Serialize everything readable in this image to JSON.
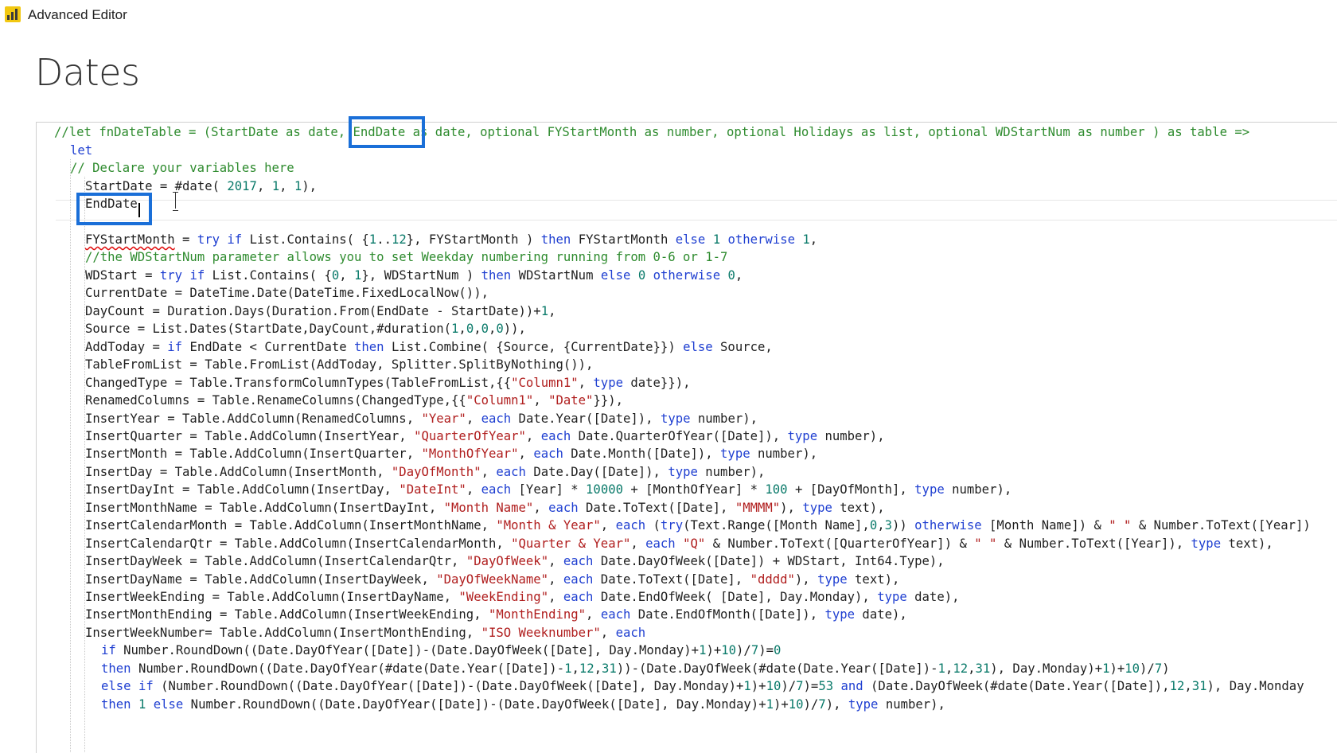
{
  "window": {
    "title": "Advanced Editor",
    "icon": "power-bi-icon"
  },
  "page": {
    "title": "Dates"
  },
  "editor": {
    "lines": [
      "//let fnDateTable = (StartDate as date, EndDate as date, optional FYStartMonth as number, optional Holidays as list, optional WDStartNum as number ) as table =>",
      "let",
      "// Declare your variables here",
      "StartDate = #date( 2017, 1, 1),",
      "EndDate",
      "FYStartMonth = try if List.Contains( {1..12}, FYStartMonth ) then FYStartMonth else 1 otherwise 1,",
      "//the WDStartNum parameter allows you to set Weekday numbering running from 0-6 or 1-7",
      "WDStart = try if List.Contains( {0, 1}, WDStartNum ) then WDStartNum else 0 otherwise 0,",
      "CurrentDate = DateTime.Date(DateTime.FixedLocalNow()),",
      "DayCount = Duration.Days(Duration.From(EndDate - StartDate))+1,",
      "Source = List.Dates(StartDate,DayCount,#duration(1,0,0,0)),",
      "AddToday = if EndDate < CurrentDate then List.Combine( {Source, {CurrentDate}}) else Source,",
      "TableFromList = Table.FromList(AddToday, Splitter.SplitByNothing()),",
      "ChangedType = Table.TransformColumnTypes(TableFromList,{{\"Column1\", type date}}),",
      "RenamedColumns = Table.RenameColumns(ChangedType,{{\"Column1\", \"Date\"}}),",
      "InsertYear = Table.AddColumn(RenamedColumns, \"Year\", each Date.Year([Date]), type number),",
      "InsertQuarter = Table.AddColumn(InsertYear, \"QuarterOfYear\", each Date.QuarterOfYear([Date]), type number),",
      "InsertMonth = Table.AddColumn(InsertQuarter, \"MonthOfYear\", each Date.Month([Date]), type number),",
      "InsertDay = Table.AddColumn(InsertMonth, \"DayOfMonth\", each Date.Day([Date]), type number),",
      "InsertDayInt = Table.AddColumn(InsertDay, \"DateInt\", each [Year] * 10000 + [MonthOfYear] * 100 + [DayOfMonth], type number),",
      "InsertMonthName = Table.AddColumn(InsertDayInt, \"Month Name\", each Date.ToText([Date], \"MMMM\"), type text),",
      "InsertCalendarMonth = Table.AddColumn(InsertMonthName, \"Month & Year\", each (try(Text.Range([Month Name],0,3)) otherwise [Month Name]) & \" \" & Number.ToText([Year])",
      "InsertCalendarQtr = Table.AddColumn(InsertCalendarMonth, \"Quarter & Year\", each \"Q\" & Number.ToText([QuarterOfYear]) & \" \" & Number.ToText([Year]), type text),",
      "InsertDayWeek = Table.AddColumn(InsertCalendarQtr, \"DayOfWeek\", each Date.DayOfWeek([Date]) + WDStart, Int64.Type),",
      "InsertDayName = Table.AddColumn(InsertDayWeek, \"DayOfWeekName\", each Date.ToText([Date], \"dddd\"), type text),",
      "InsertWeekEnding = Table.AddColumn(InsertDayName, \"WeekEnding\", each Date.EndOfWeek( [Date], Day.Monday), type date),",
      "InsertMonthEnding = Table.AddColumn(InsertWeekEnding, \"MonthEnding\", each Date.EndOfMonth([Date]), type date),",
      "InsertWeekNumber= Table.AddColumn(InsertMonthEnding, \"ISO Weeknumber\", each",
      "if Number.RoundDown((Date.DayOfYear([Date])-(Date.DayOfWeek([Date], Day.Monday)+1)+10)/7)=0",
      "then Number.RoundDown((Date.DayOfYear(#date(Date.Year([Date])-1,12,31))-(Date.DayOfWeek(#date(Date.Year([Date])-1,12,31), Day.Monday)+1)+10)/7)",
      "else if (Number.RoundDown((Date.DayOfYear([Date])-(Date.DayOfWeek([Date], Day.Monday)+1)+10)/7)=53 and (Date.DayOfWeek(#date(Date.Year([Date]),12,31), Day.Monday",
      "then 1 else Number.RoundDown((Date.DayOfYear([Date])-(Date.DayOfWeek([Date], Day.Monday)+1)+10)/7), type number),"
    ],
    "highlight_word": "EndDate"
  },
  "colors": {
    "comment": "#2e8b2e",
    "keyword": "#1f3fd1",
    "string": "#b01e1e",
    "number": "#0a7a6a",
    "highlight_box": "#1a6fd8"
  }
}
